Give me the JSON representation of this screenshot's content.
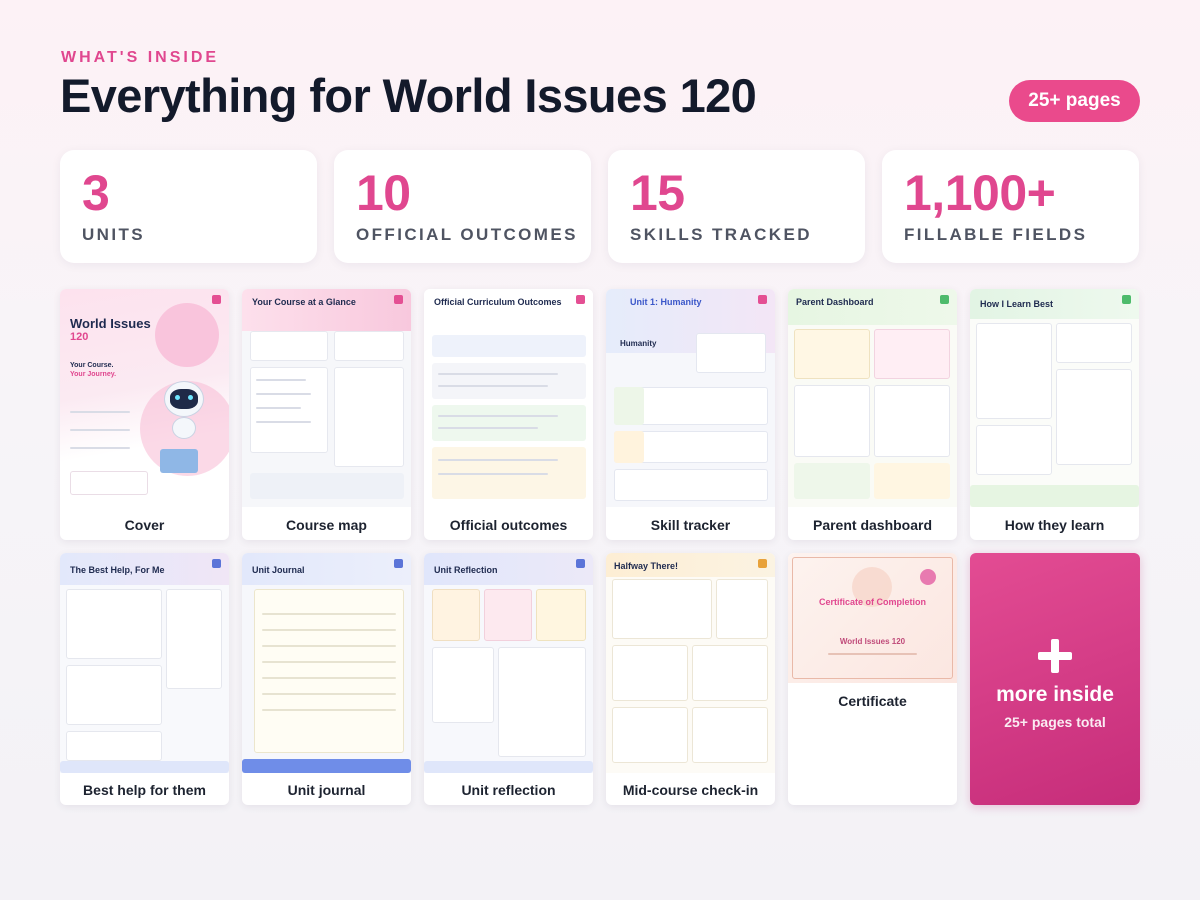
{
  "header": {
    "eyebrow": "WHAT'S INSIDE",
    "title": "Everything for World Issues 120",
    "badge": "25+ pages"
  },
  "stats": [
    {
      "value": "3",
      "label": "UNITS"
    },
    {
      "value": "10",
      "label": "OFFICIAL OUTCOMES"
    },
    {
      "value": "15",
      "label": "SKILLS TRACKED"
    },
    {
      "value": "1,100+",
      "label": "FILLABLE FIELDS"
    }
  ],
  "pages": {
    "cover": {
      "caption": "Cover",
      "title": "World Issues",
      "subtitle": "120",
      "tag1": "Your Course.",
      "tag2": "Your Journey."
    },
    "course_map": {
      "caption": "Course map",
      "title": "Your Course at a Glance"
    },
    "official_outcomes": {
      "caption": "Official outcomes",
      "title": "Official Curriculum Outcomes"
    },
    "skill_tracker": {
      "caption": "Skill tracker",
      "title": "Unit 1: Humanity",
      "heading": "Humanity"
    },
    "parent_dashboard": {
      "caption": "Parent dashboard",
      "title": "Parent Dashboard"
    },
    "how_they_learn": {
      "caption": "How they learn",
      "title": "How I Learn Best"
    },
    "best_help": {
      "caption": "Best help for them",
      "title": "The Best Help, For Me"
    },
    "unit_journal": {
      "caption": "Unit journal",
      "title": "Unit Journal"
    },
    "unit_reflection": {
      "caption": "Unit reflection",
      "title": "Unit Reflection"
    },
    "mid_course": {
      "caption": "Mid-course check-in",
      "title": "Halfway There!"
    },
    "certificate": {
      "caption": "Certificate",
      "title": "Certificate of Completion",
      "course": "World Issues 120"
    }
  },
  "more": {
    "line1": "more inside",
    "line2": "25+ pages total"
  },
  "colors": {
    "accent": "#e0478f",
    "badge": "#ea4a8c",
    "navy": "#131a2b"
  }
}
